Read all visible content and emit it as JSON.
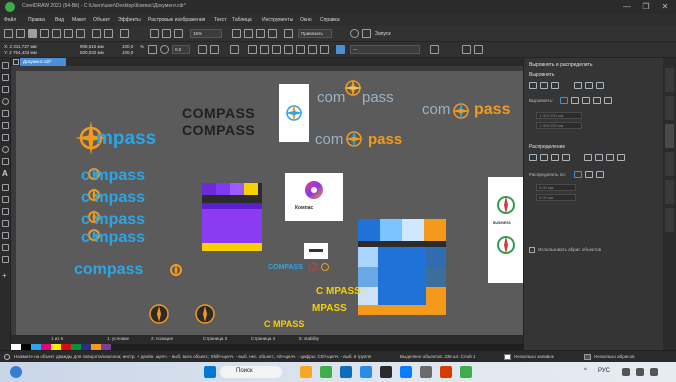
{
  "window": {
    "title": "CorelDRAW 2021 (64-Bit) - C:\\Users\\user\\Desktop\\Компас\\Документ.cdr*",
    "controls": [
      "—",
      "❐",
      "✕"
    ]
  },
  "menubar": {
    "items": [
      "Файл",
      "Правка",
      "Вид",
      "Макет",
      "Объект",
      "Эффекты",
      "Растровые изображения",
      "Текст",
      "Таблица",
      "Инструменты",
      "Окно",
      "Справка"
    ]
  },
  "toolbar": {
    "zoom_value": "15%",
    "snap_label": "Привязать",
    "launch_label": "Запуск"
  },
  "property_bar": {
    "x_value": "X: 2 311,737 мм",
    "y_value": "Y: 2 754,433 мм",
    "width_value": "908,615 мм",
    "height_value": "500,032 мм",
    "scale_x": "100,0",
    "scale_y": "100,0",
    "percent": "%",
    "angle_value": "0,0",
    "outline_value": "—"
  },
  "document": {
    "tab_label": "Документ.cdr*"
  },
  "canvas": {
    "logos": {
      "compass_mixed_1": "COMPASS",
      "compass_mixed_2": "COMPASS",
      "com_pass_top_left": "com",
      "com_pass_top_right": "pass",
      "com_pass_mid_left": "com",
      "com_pass_mid_right": "pass",
      "com_pass_right_left": "com",
      "com_pass_right_right": "pass",
      "big_mpass": "mpass",
      "blue_rows": [
        "c mpass",
        "c mpass",
        "c mpass",
        "c mpass"
      ],
      "compass_bottom": "compass",
      "square_caption": "Компас",
      "small_compass": "COMPASS",
      "small_mpass_1": "C MPASS",
      "small_mpass_2": "MPASS",
      "small_mpass_3": "C MPASS",
      "side_card_text": "BUSINESS"
    }
  },
  "pages": {
    "tabs": [
      "1 из 6",
      "1: условие",
      "2: позиция",
      "Страница 3",
      "Страница 4",
      "5: stability"
    ]
  },
  "dock": {
    "panel_title": "Выровнять и распределить",
    "align_section": "Выровнять",
    "align_to_label": "Выровнять:",
    "distribute_section": "Распределение",
    "distribute_to_label": "Распределить по:",
    "use_text_label": "Использовать абрис объектов",
    "field_1": "1 000,000 мм",
    "field_2": "1 000,000 мм",
    "field_3": "0,00 мм",
    "field_4": "0,00 мм"
  },
  "statusbar": {
    "hint": "Нажмите на объект дважды для поворота/наклона; инстр. + двойн. щелч. - выб. всех объект.; Shift+щелч. - выб. нес. объект.; Alt+щелч. - цифры; Ctrl+щелч. - выб. в группе",
    "selection": "Выделено объектов: 336 шт. Слой 1",
    "fill_label": "Несколько заливок",
    "outline_label": "Несколько абрисов"
  },
  "taskbar": {
    "search_label": "Поиск",
    "lang_label": "РУС",
    "time_label": "^"
  },
  "colors": {
    "accent_blue": "#2aa6e6",
    "accent_orange": "#f39a1c",
    "canvas_bg": "#5b5b5b",
    "selection_blue": "#4a90d9"
  }
}
